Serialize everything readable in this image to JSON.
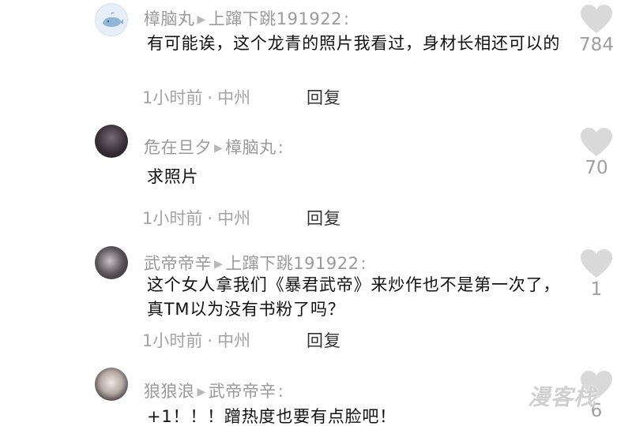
{
  "comments": [
    {
      "author": "樟脑丸",
      "reply_to": "上蹿下跳191922",
      "text": "有可能诶，这个龙青的照片我看过，身材长相还可以的",
      "time": "1小时前",
      "location": "中州",
      "reply_label": "回复",
      "likes": "784"
    },
    {
      "author": "危在旦夕",
      "reply_to": "樟脑丸",
      "text": "求照片",
      "time": "1小时前",
      "location": "中州",
      "reply_label": "回复",
      "likes": "70"
    },
    {
      "author": "武帝帝辛",
      "reply_to": "上蹿下跳191922",
      "text": "这个女人拿我们《暴君武帝》来炒作也不是第一次了，真TM以为没有书粉了吗？",
      "time": "1小时前",
      "location": "中州",
      "reply_label": "回复",
      "likes": "1"
    },
    {
      "author": "狼狼浪",
      "reply_to": "武帝帝辛",
      "text": "+1！！！蹭热度也要有点脸吧！",
      "time": "",
      "location": "",
      "reply_label": "",
      "likes": "6"
    }
  ],
  "separator": "·",
  "colon": ":",
  "watermark": "漫客栈",
  "colors": {
    "heart": "#d9d9d9",
    "meta": "#a3a3a3",
    "author": "#9a9a9a"
  }
}
